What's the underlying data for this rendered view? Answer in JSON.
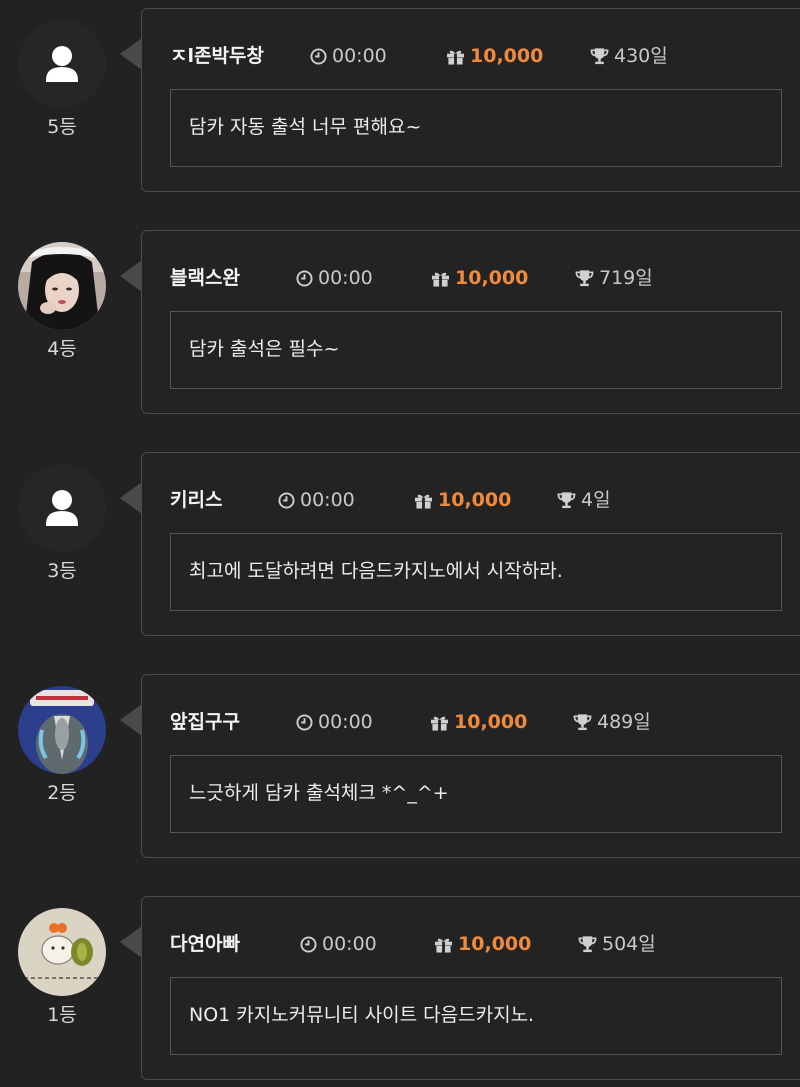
{
  "attendance_list": [
    {
      "rank": "5등",
      "avatar": "default-user-icon",
      "name": "ㅈl존박두창",
      "time": "00:00",
      "points": "10,000",
      "days": "430일",
      "message": "담카 자동 출석 너무 편해요~"
    },
    {
      "rank": "4등",
      "avatar": "profile-photo-woman",
      "name": "블랙스완",
      "time": "00:00",
      "points": "10,000",
      "days": "719일",
      "message": "담카 출석은 필수~"
    },
    {
      "rank": "3등",
      "avatar": "default-user-icon",
      "name": "키리스",
      "time": "00:00",
      "points": "10,000",
      "days": "4일",
      "message": "최고에 도달하려면 다음드카지노에서 시작하라."
    },
    {
      "rank": "2등",
      "avatar": "cartoon-avatar",
      "name": "앞집구구",
      "time": "00:00",
      "points": "10,000",
      "days": "489일",
      "message": "느긋하게 담카 출석체크 *^_^+"
    },
    {
      "rank": "1등",
      "avatar": "hamster-drawing-avatar",
      "name": "다연아빠",
      "time": "00:00",
      "points": "10,000",
      "days": "504일",
      "message": "NO1 카지노커뮤니티 사이트 다음드카지노."
    }
  ],
  "colors": {
    "background": "#222222",
    "points_accent": "#f08a3c",
    "border": "#4a4a4a"
  }
}
